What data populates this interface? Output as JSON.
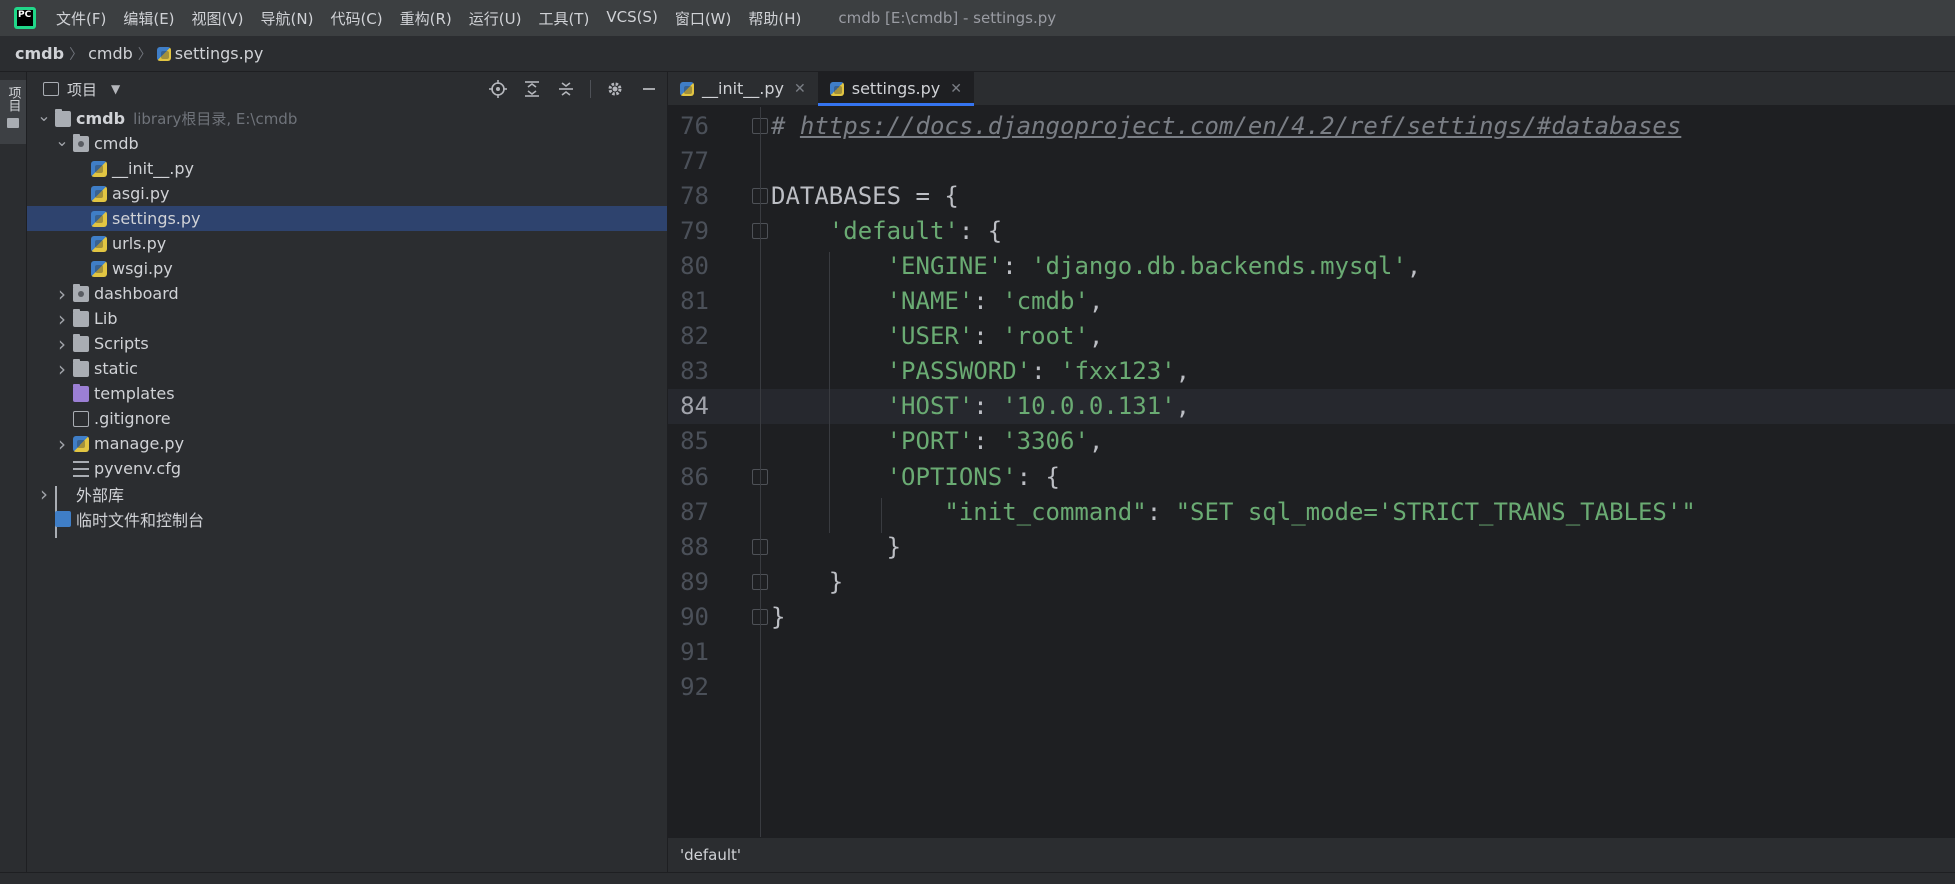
{
  "app": {
    "logo_text": "PC",
    "window_title": "cmdb [E:\\cmdb] - settings.py"
  },
  "menu": [
    {
      "label": "文件(F)"
    },
    {
      "label": "编辑(E)"
    },
    {
      "label": "视图(V)"
    },
    {
      "label": "导航(N)"
    },
    {
      "label": "代码(C)"
    },
    {
      "label": "重构(R)"
    },
    {
      "label": "运行(U)"
    },
    {
      "label": "工具(T)"
    },
    {
      "label": "VCS(S)"
    },
    {
      "label": "窗口(W)"
    },
    {
      "label": "帮助(H)"
    }
  ],
  "breadcrumb": [
    "cmdb",
    "cmdb",
    "settings.py"
  ],
  "tool_strip": {
    "project_tab": "项目"
  },
  "project_panel": {
    "title": "项目",
    "tools": [
      "locate-icon",
      "expand-all-icon",
      "collapse-all-icon",
      "gear-icon",
      "minimize-icon"
    ],
    "tree": [
      {
        "indent": 0,
        "arrow": "down",
        "icon": "folder",
        "label": "cmdb",
        "bold": true,
        "hint": "library根目录, E:\\cmdb"
      },
      {
        "indent": 1,
        "arrow": "down",
        "icon": "package",
        "label": "cmdb"
      },
      {
        "indent": 2,
        "arrow": "",
        "icon": "python",
        "label": "__init__.py"
      },
      {
        "indent": 2,
        "arrow": "",
        "icon": "python",
        "label": "asgi.py"
      },
      {
        "indent": 2,
        "arrow": "",
        "icon": "python",
        "label": "settings.py",
        "selected": true
      },
      {
        "indent": 2,
        "arrow": "",
        "icon": "python",
        "label": "urls.py"
      },
      {
        "indent": 2,
        "arrow": "",
        "icon": "python",
        "label": "wsgi.py"
      },
      {
        "indent": 1,
        "arrow": "right",
        "icon": "package",
        "label": "dashboard"
      },
      {
        "indent": 1,
        "arrow": "right",
        "icon": "folder",
        "label": "Lib"
      },
      {
        "indent": 1,
        "arrow": "right",
        "icon": "folder",
        "label": "Scripts"
      },
      {
        "indent": 1,
        "arrow": "right",
        "icon": "folder",
        "label": "static"
      },
      {
        "indent": 1,
        "arrow": "",
        "icon": "folder-purple",
        "label": "templates"
      },
      {
        "indent": 1,
        "arrow": "",
        "icon": "git",
        "label": ".gitignore"
      },
      {
        "indent": 1,
        "arrow": "right",
        "icon": "python",
        "label": "manage.py"
      },
      {
        "indent": 1,
        "arrow": "",
        "icon": "config",
        "label": "pyvenv.cfg"
      },
      {
        "indent": 0,
        "arrow": "right",
        "icon": "library",
        "label": "外部库"
      },
      {
        "indent": 0,
        "arrow": "",
        "icon": "scratch",
        "label": "临时文件和控制台"
      }
    ]
  },
  "tabs": [
    {
      "label": "__init__.py",
      "active": false
    },
    {
      "label": "settings.py",
      "active": true
    }
  ],
  "editor": {
    "current_line": 84,
    "lines": [
      {
        "n": "76",
        "tokens": [
          {
            "t": "comment",
            "v": "# "
          },
          {
            "t": "link",
            "v": "https://docs.djangoproject.com/en/4.2/ref/settings/#databases"
          }
        ]
      },
      {
        "n": "77",
        "tokens": []
      },
      {
        "n": "78",
        "tokens": [
          {
            "t": "plain",
            "v": "DATABASES = {"
          }
        ]
      },
      {
        "n": "79",
        "tokens": [
          {
            "t": "plain",
            "v": "    "
          },
          {
            "t": "str",
            "v": "'default'"
          },
          {
            "t": "plain",
            "v": ": {"
          }
        ]
      },
      {
        "n": "80",
        "tokens": [
          {
            "t": "plain",
            "v": "        "
          },
          {
            "t": "str",
            "v": "'ENGINE'"
          },
          {
            "t": "plain",
            "v": ": "
          },
          {
            "t": "str",
            "v": "'django.db.backends.mysql'"
          },
          {
            "t": "plain",
            "v": ","
          }
        ]
      },
      {
        "n": "81",
        "tokens": [
          {
            "t": "plain",
            "v": "        "
          },
          {
            "t": "str",
            "v": "'NAME'"
          },
          {
            "t": "plain",
            "v": ": "
          },
          {
            "t": "str",
            "v": "'cmdb'"
          },
          {
            "t": "plain",
            "v": ","
          }
        ]
      },
      {
        "n": "82",
        "tokens": [
          {
            "t": "plain",
            "v": "        "
          },
          {
            "t": "str",
            "v": "'USER'"
          },
          {
            "t": "plain",
            "v": ": "
          },
          {
            "t": "str",
            "v": "'root'"
          },
          {
            "t": "plain",
            "v": ","
          }
        ]
      },
      {
        "n": "83",
        "tokens": [
          {
            "t": "plain",
            "v": "        "
          },
          {
            "t": "str",
            "v": "'PASSWORD'"
          },
          {
            "t": "plain",
            "v": ": "
          },
          {
            "t": "str",
            "v": "'fxx123'"
          },
          {
            "t": "plain",
            "v": ","
          }
        ]
      },
      {
        "n": "84",
        "tokens": [
          {
            "t": "plain",
            "v": "        "
          },
          {
            "t": "str",
            "v": "'HOST'"
          },
          {
            "t": "plain",
            "v": ": "
          },
          {
            "t": "str",
            "v": "'10.0.0.131'"
          },
          {
            "t": "plain",
            "v": ","
          }
        ]
      },
      {
        "n": "85",
        "tokens": [
          {
            "t": "plain",
            "v": "        "
          },
          {
            "t": "str",
            "v": "'PORT'"
          },
          {
            "t": "plain",
            "v": ": "
          },
          {
            "t": "str",
            "v": "'3306'"
          },
          {
            "t": "plain",
            "v": ","
          }
        ]
      },
      {
        "n": "86",
        "tokens": [
          {
            "t": "plain",
            "v": "        "
          },
          {
            "t": "str",
            "v": "'OPTIONS'"
          },
          {
            "t": "plain",
            "v": ": {"
          }
        ]
      },
      {
        "n": "87",
        "tokens": [
          {
            "t": "plain",
            "v": "            "
          },
          {
            "t": "str",
            "v": "\"init_command\""
          },
          {
            "t": "plain",
            "v": ": "
          },
          {
            "t": "str",
            "v": "\"SET sql_mode='STRICT_TRANS_TABLES'\""
          }
        ]
      },
      {
        "n": "88",
        "tokens": [
          {
            "t": "plain",
            "v": "        }"
          }
        ]
      },
      {
        "n": "89",
        "tokens": [
          {
            "t": "plain",
            "v": "    }"
          }
        ]
      },
      {
        "n": "90",
        "tokens": [
          {
            "t": "plain",
            "v": "}"
          }
        ]
      },
      {
        "n": "91",
        "tokens": []
      },
      {
        "n": "92",
        "tokens": []
      }
    ],
    "fold_lines": [
      "76",
      "78",
      "79",
      "86",
      "88",
      "89",
      "90"
    ]
  },
  "editor_crumb": "'default'",
  "colors": {
    "accent": "#3574f0",
    "string": "#6aab73",
    "selection": "#2e436e"
  }
}
